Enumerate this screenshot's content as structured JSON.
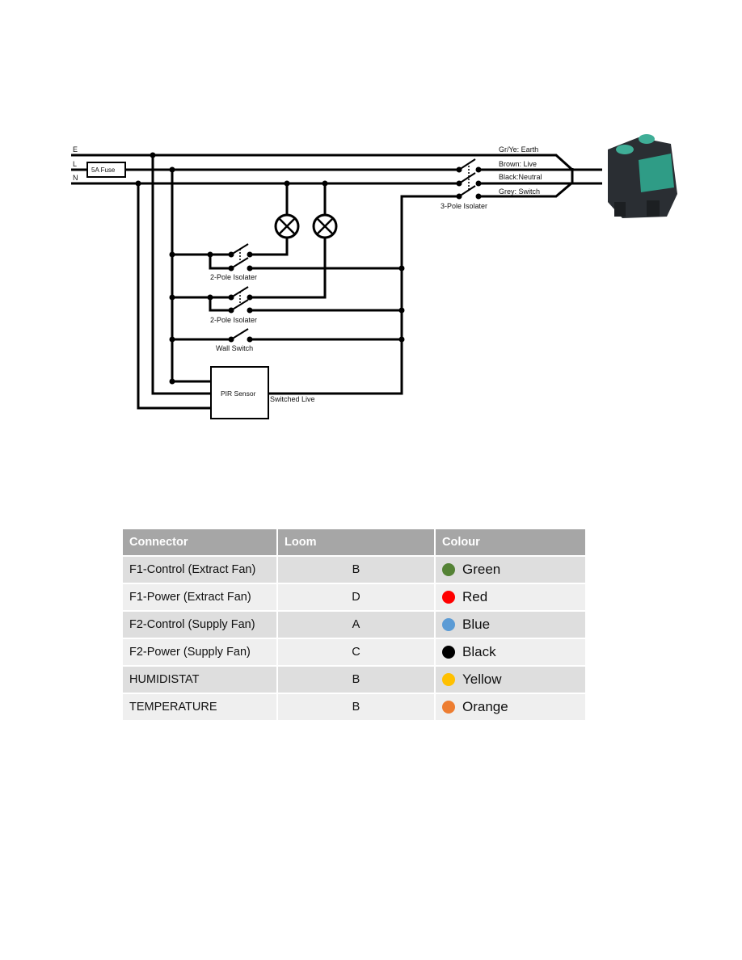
{
  "diagram": {
    "line_labels": {
      "earth": "E",
      "live": "L",
      "neutral": "N"
    },
    "fuse": "5A Fuse",
    "wire_labels": [
      "Gr/Ye: Earth",
      "Brown: Live",
      "Black:Neutral",
      "Grey: Switch"
    ],
    "three_pole": "3-Pole Isolater",
    "isolator_1": "2-Pole Isolater",
    "isolator_2": "2-Pole Isolater",
    "wall_switch": "Wall Switch",
    "pir": "PIR Sensor",
    "switched_live": "Switched Live"
  },
  "table": {
    "headers": [
      "Connector",
      "Loom",
      "Colour"
    ],
    "rows": [
      {
        "connector": "F1-Control (Extract Fan)",
        "loom": "B",
        "colour": "Green",
        "hex": "#548235"
      },
      {
        "connector": "F1-Power (Extract Fan)",
        "loom": "D",
        "colour": "Red",
        "hex": "#ff0000"
      },
      {
        "connector": "F2-Control (Supply Fan)",
        "loom": "A",
        "colour": "Blue",
        "hex": "#5b9bd5"
      },
      {
        "connector": "F2-Power (Supply Fan)",
        "loom": "C",
        "colour": "Black",
        "hex": "#000000"
      },
      {
        "connector": "HUMIDISTAT",
        "loom": "B",
        "colour": "Yellow",
        "hex": "#ffc000"
      },
      {
        "connector": "TEMPERATURE",
        "loom": "B",
        "colour": "Orange",
        "hex": "#ed7d31"
      }
    ]
  }
}
